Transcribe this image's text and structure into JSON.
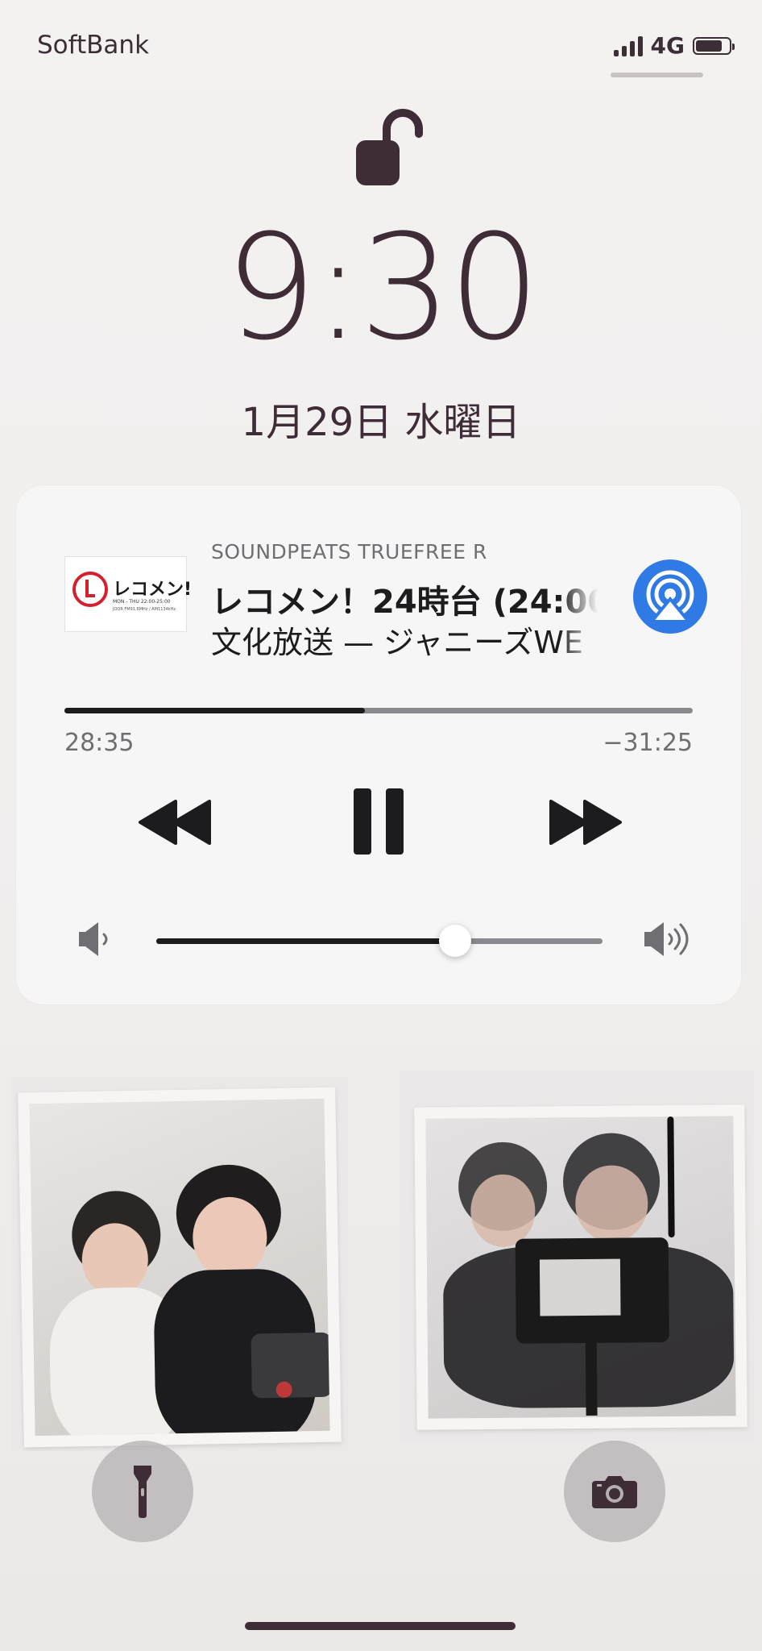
{
  "status_bar": {
    "carrier": "SoftBank",
    "network": "4G",
    "battery_level": 0.8
  },
  "lock_screen": {
    "lock_icon": "unlocked-padlock-icon",
    "time": "9:30",
    "date": "1月29日 水曜日"
  },
  "now_playing": {
    "artwork": {
      "logo_text": "レコメン!",
      "schedule_text": "MON - THU 22:00-25:00",
      "station_text": "JOQR FM91.6MHz / AM1134kHz"
    },
    "device": "SOUNDPEATS TRUEFREE R",
    "title": "レコメン！24時台 (24:00",
    "artist": "文化放送 — ジャニーズWE",
    "airplay_icon": "airplay-audio-icon",
    "elapsed": "28:35",
    "remaining": "−31:25",
    "progress": 0.478,
    "controls": {
      "rewind_icon": "rewind-icon",
      "pause_icon": "pause-icon",
      "forward_icon": "fast-forward-icon"
    },
    "volume": 0.67,
    "volume_low_icon": "speaker-low-icon",
    "volume_high_icon": "speaker-high-icon"
  },
  "quick_actions": {
    "flashlight_icon": "flashlight-icon",
    "camera_icon": "camera-icon"
  },
  "colors": {
    "text": "#3e2c37",
    "airplay": "#2f7ae5",
    "card": "#f6f6f7"
  }
}
